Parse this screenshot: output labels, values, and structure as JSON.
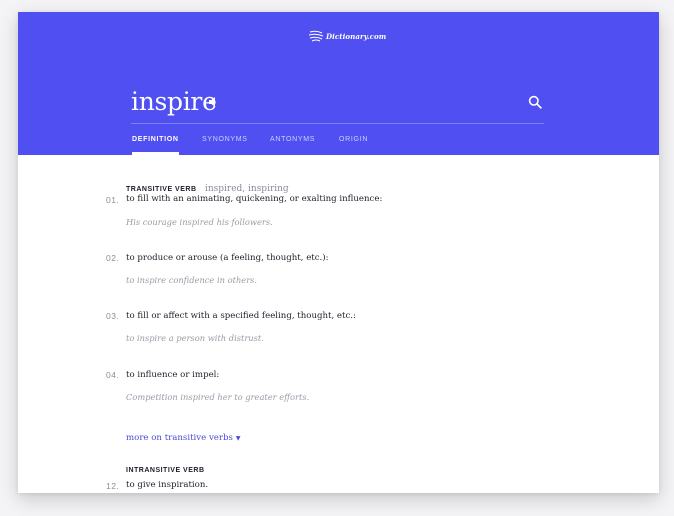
{
  "header": {
    "logo_text": "Dictionary.com",
    "word": "inspire",
    "tabs": [
      "DEFINITION",
      "SYNONYMS",
      "ANTONYMS",
      "ORIGIN"
    ],
    "active_tab": "DEFINITION"
  },
  "icons": {
    "speaker": "speaker-icon",
    "search": "search-icon",
    "logo": "dictionary-logo-icon",
    "more": "caret-down-icon"
  },
  "colors": {
    "header_bg": "#4f4ff2",
    "link": "#4a4ad8"
  },
  "entry": {
    "part_of_speech": "TRANSITIVE VERB",
    "inflections": "inspired, inspiring",
    "definitions": [
      {
        "num": "01.",
        "text": "to fill with an animating, quickening, or exalting influence:",
        "example": "His courage inspired his followers."
      },
      {
        "num": "02.",
        "text": "to produce or arouse (a feeling, thought, etc.):",
        "example": "to inspire confidence in others."
      },
      {
        "num": "03.",
        "text": "to fill or affect with a specified feeling, thought, etc.:",
        "example": "to inspire a person with distrust."
      },
      {
        "num": "04.",
        "text": "to influence or impel:",
        "example": "Competition inspired her to greater efforts."
      }
    ],
    "more_link": "more on transitive verbs",
    "more_caret": "▼",
    "part_of_speech_2": "INTRANSITIVE VERB",
    "definition_2": {
      "num": "12.",
      "text": "to give inspiration."
    }
  }
}
